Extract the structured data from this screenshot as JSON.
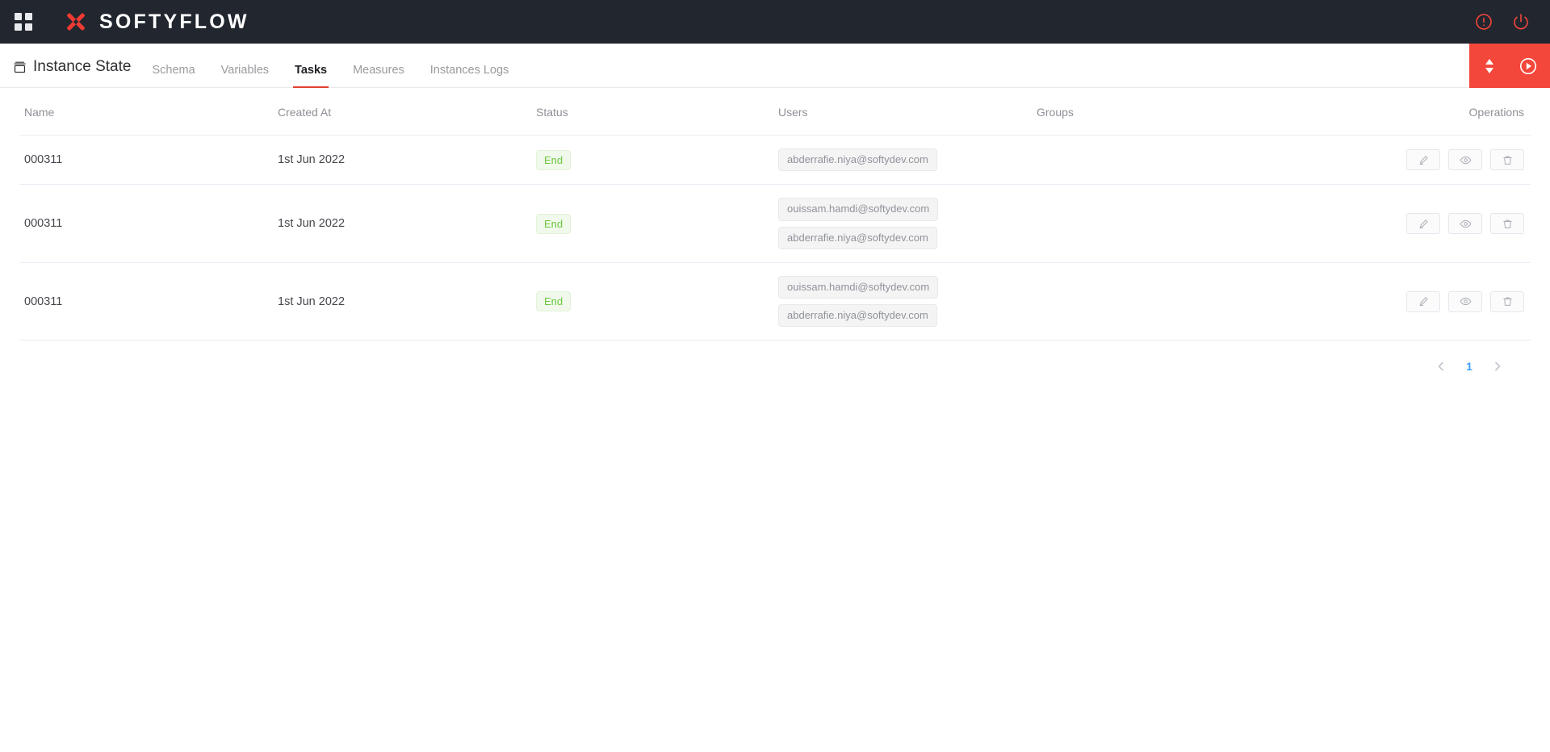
{
  "navbar": {
    "apps_icon": "grid-apps-icon",
    "brand_name": "SOFTYFLOW",
    "brand_logo_icon": "softyflow-x-logo",
    "alert_icon": "exclamation-circle-icon",
    "power_icon": "power-off-icon",
    "background": "#22262F",
    "accent": "#F4473B"
  },
  "tabstrip": {
    "instance_state": {
      "icon": "archive-box-icon",
      "label": "Instance State"
    },
    "tabs": [
      {
        "label": "Schema",
        "active": false
      },
      {
        "label": "Variables",
        "active": false
      },
      {
        "label": "Tasks",
        "active": true
      },
      {
        "label": "Measures",
        "active": false
      },
      {
        "label": "Instances Logs",
        "active": false
      }
    ],
    "active_underline_color": "#E2402F",
    "action_bar": {
      "background": "#F4473B",
      "sort_icon": "sort-up-down-icon",
      "run_icon": "play-circle-icon"
    }
  },
  "table": {
    "columns": [
      "Name",
      "Created At",
      "Status",
      "Users",
      "Groups",
      "Operations"
    ],
    "rows": [
      {
        "name": "000311",
        "created_at": "1st Jun 2022",
        "status": "End",
        "users": [
          "abderrafie.niya@softydev.com"
        ],
        "groups": [],
        "operations": [
          "edit-icon",
          "view-eye-icon",
          "delete-trash-icon"
        ]
      },
      {
        "name": "000311",
        "created_at": "1st Jun 2022",
        "status": "End",
        "users": [
          "ouissam.hamdi@softydev.com",
          "abderrafie.niya@softydev.com"
        ],
        "groups": [],
        "operations": [
          "edit-icon",
          "view-eye-icon",
          "delete-trash-icon"
        ]
      },
      {
        "name": "000311",
        "created_at": "1st Jun 2022",
        "status": "End",
        "users": [
          "ouissam.hamdi@softydev.com",
          "abderrafie.niya@softydev.com"
        ],
        "groups": [],
        "operations": [
          "edit-icon",
          "view-eye-icon",
          "delete-trash-icon"
        ]
      }
    ],
    "status_colors": {
      "End": {
        "text": "#6BC73E",
        "bg": "#F0F9EB",
        "border": "#E1F3D8"
      }
    }
  },
  "pagination": {
    "prev_icon": "chevron-left-icon",
    "next_icon": "chevron-right-icon",
    "pages": [
      "1"
    ],
    "current_page": "1",
    "active_color": "#409EFF"
  }
}
